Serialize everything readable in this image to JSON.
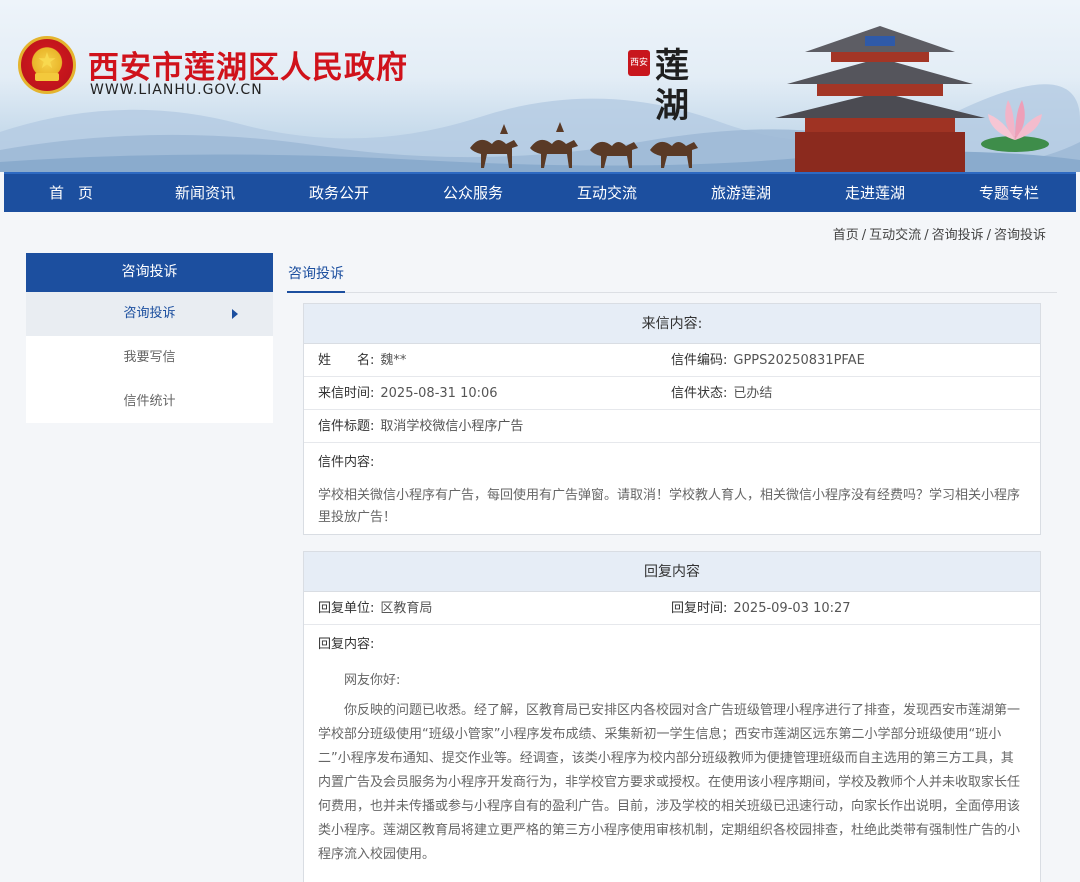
{
  "header": {
    "site_title": "西安市莲湖区人民政府",
    "site_url": "WWW.LIANHU.GOV.CN",
    "seal_text": "西安",
    "calligraphy": "莲湖"
  },
  "nav": {
    "items": [
      "首页",
      "新闻资讯",
      "政务公开",
      "公众服务",
      "互动交流",
      "旅游莲湖",
      "走进莲湖",
      "专题专栏"
    ]
  },
  "breadcrumb": [
    "首页",
    "互动交流",
    "咨询投诉",
    "咨询投诉"
  ],
  "sidebar": {
    "title": "咨询投诉",
    "items": [
      "咨询投诉",
      "我要写信",
      "信件统计"
    ]
  },
  "tab": {
    "label": "咨询投诉"
  },
  "letter": {
    "heading": "来信内容:",
    "name_label": "姓　　名:",
    "name_value": "魏**",
    "code_label": "信件编码:",
    "code_value": "GPPS20250831PFAE",
    "time_label": "来信时间:",
    "time_value": "2025-08-31 10:06",
    "status_label": "信件状态:",
    "status_value": "已办结",
    "subject_label": "信件标题:",
    "subject_value": "取消学校微信小程序广告",
    "content_label": "信件内容:",
    "content_value": "学校相关微信小程序有广告，每回使用有广告弹窗。请取消！学校教人育人，相关微信小程序没有经费吗？学习相关小程序里投放广告！"
  },
  "reply": {
    "heading": "回复内容",
    "unit_label": "回复单位:",
    "unit_value": "区教育局",
    "time_label": "回复时间:",
    "time_value": "2025-09-03 10:27",
    "content_label": "回复内容:",
    "greeting": "网友你好:",
    "body": "你反映的问题已收悉。经了解，区教育局已安排区内各校园对含广告班级管理小程序进行了排查，发现西安市莲湖第一学校部分班级使用“班级小管家”小程序发布成绩、采集新初一学生信息；西安市莲湖区远东第二小学部分班级使用“班小二”小程序发布通知、提交作业等。经调查，该类小程序为校内部分班级教师为便捷管理班级而自主选用的第三方工具，其内置广告及会员服务为小程序开发商行为，非学校官方要求或授权。在使用该小程序期间，学校及教师个人并未收取家长任何费用，也并未传播或参与小程序自有的盈利广告。目前，涉及学校的相关班级已迅速行动，向家长作出说明，全面停用该类小程序。莲湖区教育局将建立更严格的第三方小程序使用审核机制，定期组织各校园排查，杜绝此类带有强制性广告的小程序流入校园使用。"
  }
}
